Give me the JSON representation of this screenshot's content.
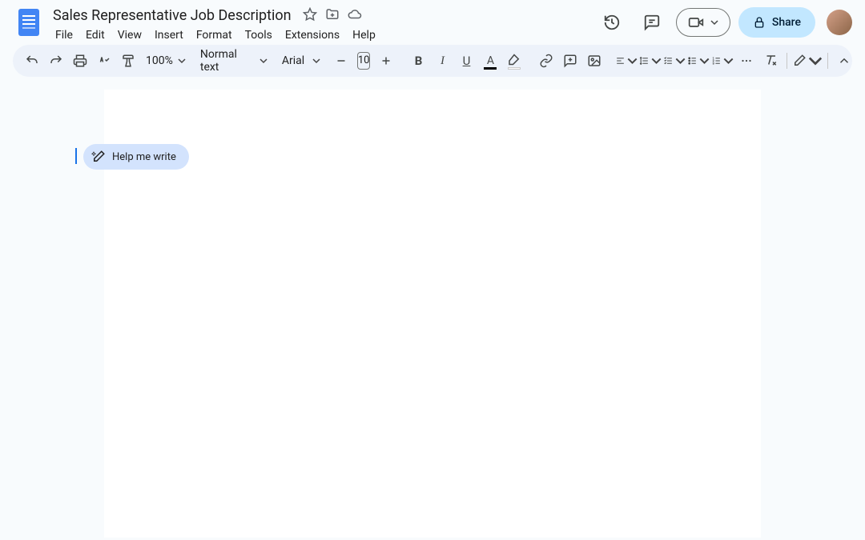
{
  "header": {
    "title": "Sales Representative Job Description",
    "share_label": "Share"
  },
  "menu": {
    "file": "File",
    "edit": "Edit",
    "view": "View",
    "insert": "Insert",
    "format": "Format",
    "tools": "Tools",
    "extensions": "Extensions",
    "help": "Help"
  },
  "toolbar": {
    "zoom": "100%",
    "style": "Normal text",
    "font": "Arial",
    "font_size": "10"
  },
  "document": {
    "help_me_write": "Help me write"
  }
}
